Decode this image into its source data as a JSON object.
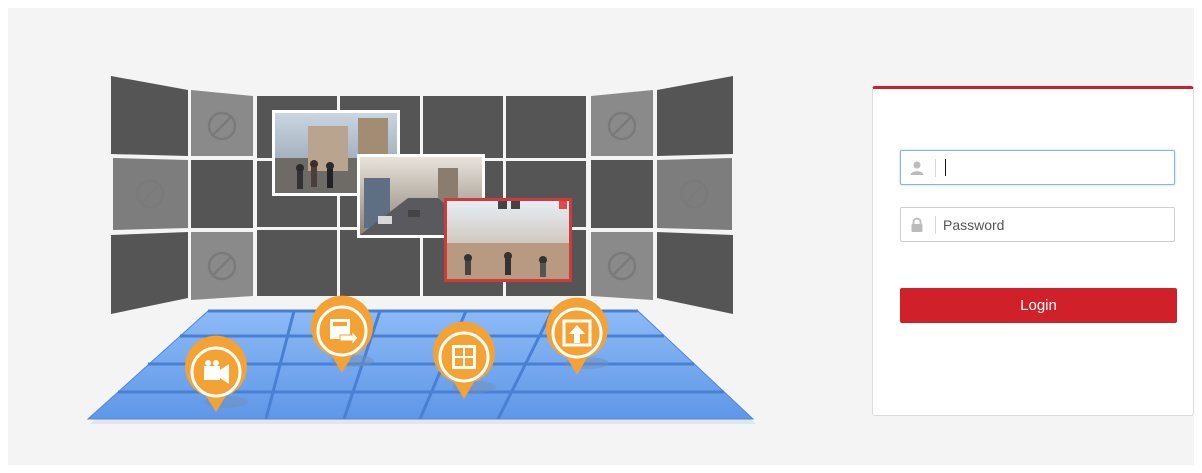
{
  "login": {
    "username_value": "",
    "username_placeholder": "",
    "password_placeholder": "Password",
    "login_label": "Login"
  },
  "icons": {
    "username_field": "user-icon",
    "password_field": "lock-icon",
    "disabled_cells": "no-entry-icon",
    "pins": [
      "video-camera-icon",
      "video-transfer-icon",
      "layout-grid-icon",
      "upload-screen-icon"
    ]
  },
  "colors": {
    "accent": "#d0212a",
    "pin_orange": "#f4a234",
    "floor_blue": "#6aa2ee",
    "wall_cell": "#555555"
  }
}
